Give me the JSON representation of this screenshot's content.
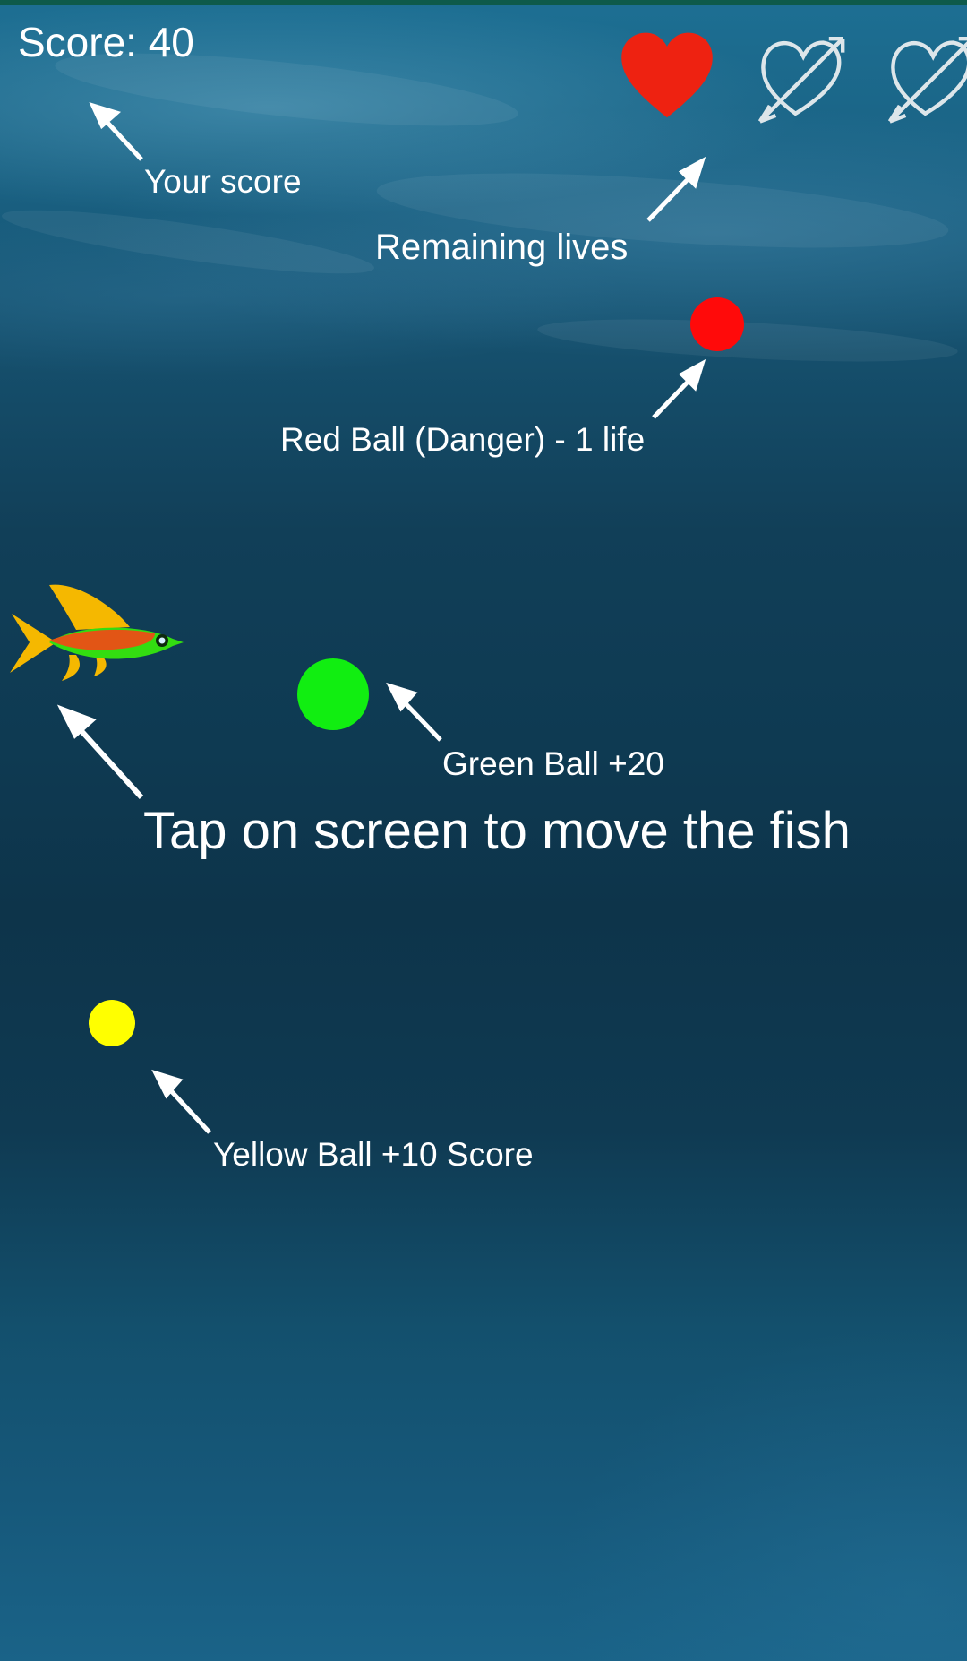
{
  "hud": {
    "score_text": "Score: 40",
    "lives_full": 1,
    "lives_lost": 2,
    "lives_total": 3
  },
  "annotations": {
    "score": "Your score",
    "lives": "Remaining lives",
    "red_ball": "Red Ball (Danger) - 1 life",
    "green_ball": "Green Ball +20",
    "yellow_ball": "Yellow Ball +10 Score",
    "instruction": "Tap on screen to move the fish"
  },
  "colors": {
    "heart_full": "#ee2211",
    "heart_lost_outline": "#dde6ea",
    "red_ball": "#ff0a0a",
    "green_ball": "#11ee11",
    "yellow_ball": "#ffff00",
    "text": "#ffffff"
  },
  "icons": {
    "life_full": "heart-icon",
    "life_lost": "heart-arrow-outline-icon",
    "player": "fish-icon"
  }
}
